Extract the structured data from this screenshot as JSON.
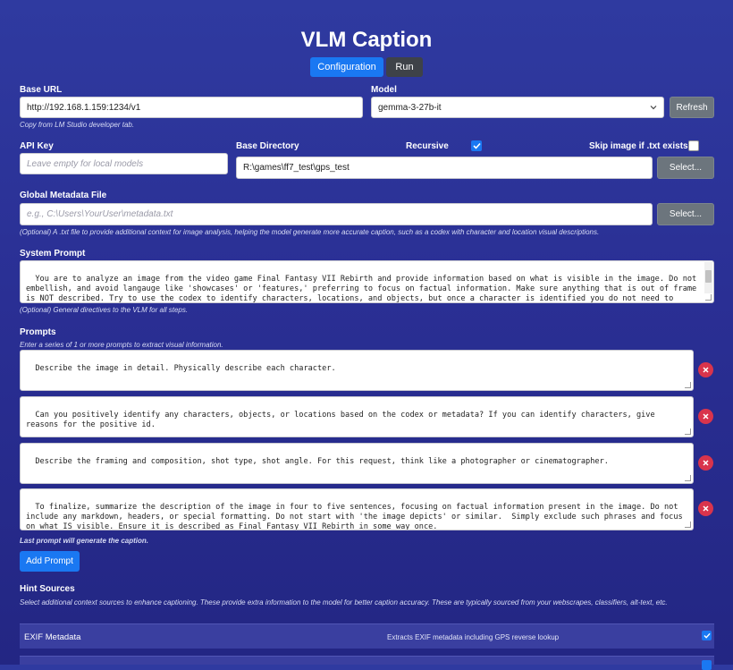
{
  "app": {
    "title": "VLM Caption"
  },
  "tabs": [
    {
      "label": "Configuration"
    },
    {
      "label": "Run"
    }
  ],
  "base_url": {
    "label": "Base URL",
    "value": "http://192.168.1.159:1234/v1",
    "hint": "Copy from LM Studio developer tab."
  },
  "model": {
    "label": "Model",
    "value": "gemma-3-27b-it",
    "refresh_label": "Refresh"
  },
  "api_key": {
    "label": "API Key",
    "placeholder": "Leave empty for local models"
  },
  "base_directory": {
    "label": "Base Directory",
    "value": "R:\\games\\ff7_test\\gps_test",
    "select_label": "Select..."
  },
  "recursive": {
    "label": "Recursive",
    "checked": true
  },
  "skip_image": {
    "label": "Skip image if .txt exists",
    "checked": false
  },
  "metadata": {
    "label": "Global Metadata File",
    "placeholder": "e.g., C:\\Users\\YourUser\\metadata.txt",
    "select_label": "Select...",
    "hint": "(Optional) A .txt file to provide additional context for image analysis, helping the model generate more accurate caption, such as a codex with character and location visual descriptions."
  },
  "system_prompt": {
    "label": "System Prompt",
    "value": "You are to analyze an image from the video game Final Fantasy VII Rebirth and provide information based on what is visible in the image. Do not embellish, and avoid langauge like 'showcases' or 'features,' preferring to focus on factual information. Make sure anything that is out of frame is NOT described. Try to use the codex to identify characters, locations, and objects, but once a character is identified you do not need to describe them in great detail in further responses. If json metadata is present it can be",
    "hint": "(Optional) General directives to the VLM for all steps."
  },
  "prompts": {
    "label": "Prompts",
    "hint": "Enter a series of 1 or more prompts to extract visual information.",
    "items": [
      "Describe the image in detail. Physically describe each character.",
      "Can you positively identify any characters, objects, or locations based on the codex or metadata? If you can identify characters, give reasons for the positive id.",
      "Describe the framing and composition, shot type, shot angle. For this request, think like a photographer or cinematographer.",
      "To finalize, summarize the description of the image in four to five sentences, focusing on factual information present in the image. Do not include any markdown, headers, or special formatting. Do not start with 'the image depicts' or similar.  Simply exclude such phrases and focus on what IS visible. Ensure it is described as Final Fantasy VII Rebirth in some way once."
    ],
    "footer": "Last prompt will generate the caption.",
    "add_label": "Add Prompt"
  },
  "hint_sources": {
    "label": "Hint Sources",
    "hint": "Select additional context sources to enhance captioning. These provide extra information to the model for better caption accuracy. These are typically sourced from your webscrapes, classifiers, alt-text, etc.",
    "items": [
      {
        "name": "EXIF Metadata",
        "description": "Extracts EXIF metadata including GPS reverse lookup",
        "checked": true
      }
    ]
  },
  "colors": {
    "accent": "#1a78f2",
    "danger": "#d9344c",
    "secondary": "#6c757d",
    "bg": "#2a2f94"
  },
  "icons": {
    "check": "check-icon",
    "remove": "close-icon",
    "dropdown": "chevron-down-icon"
  }
}
